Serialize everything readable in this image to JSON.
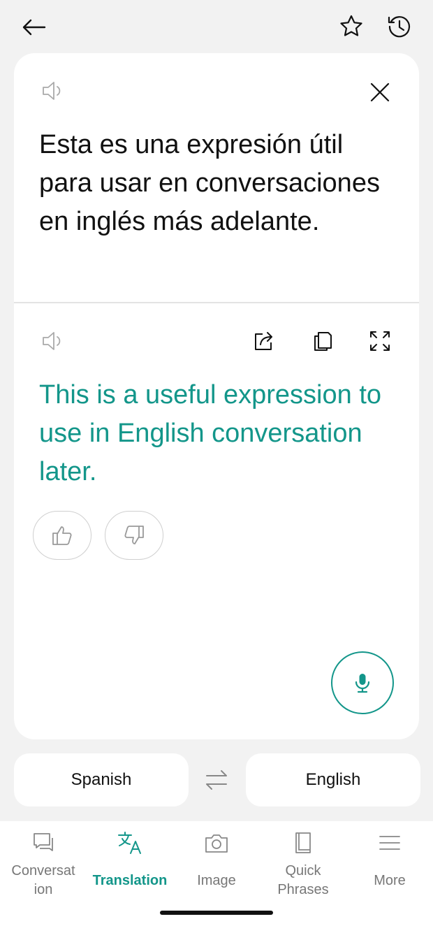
{
  "top_bar": {
    "back_icon": "arrow-left-icon",
    "favorite_icon": "star-outline-icon",
    "history_icon": "history-clock-icon"
  },
  "source": {
    "text": "Esta es una expresión útil para usar en conversaciones en inglés más adelante.",
    "speaker_icon": "speaker-icon",
    "clear_icon": "close-icon"
  },
  "target": {
    "text": "This is a useful expression to use in English conversation later.",
    "speaker_icon": "speaker-icon",
    "share_icon": "share-icon",
    "copy_icon": "copy-icon",
    "expand_icon": "expand-icon",
    "thumbs_up_icon": "thumbs-up-icon",
    "thumbs_down_icon": "thumbs-down-icon"
  },
  "mic_icon": "microphone-icon",
  "languages": {
    "from": "Spanish",
    "to": "English",
    "swap_icon": "swap-arrows-icon"
  },
  "nav": {
    "items": [
      {
        "label": "Conversat\nion",
        "icon": "conversation-icon"
      },
      {
        "label": "Translation",
        "icon": "translate-icon"
      },
      {
        "label": "Image",
        "icon": "camera-icon"
      },
      {
        "label": "Quick\nPhrases",
        "icon": "book-icon"
      },
      {
        "label": "More",
        "icon": "menu-icon"
      }
    ]
  },
  "colors": {
    "accent": "#13968a",
    "background": "#f2f2f2",
    "card": "#ffffff"
  }
}
